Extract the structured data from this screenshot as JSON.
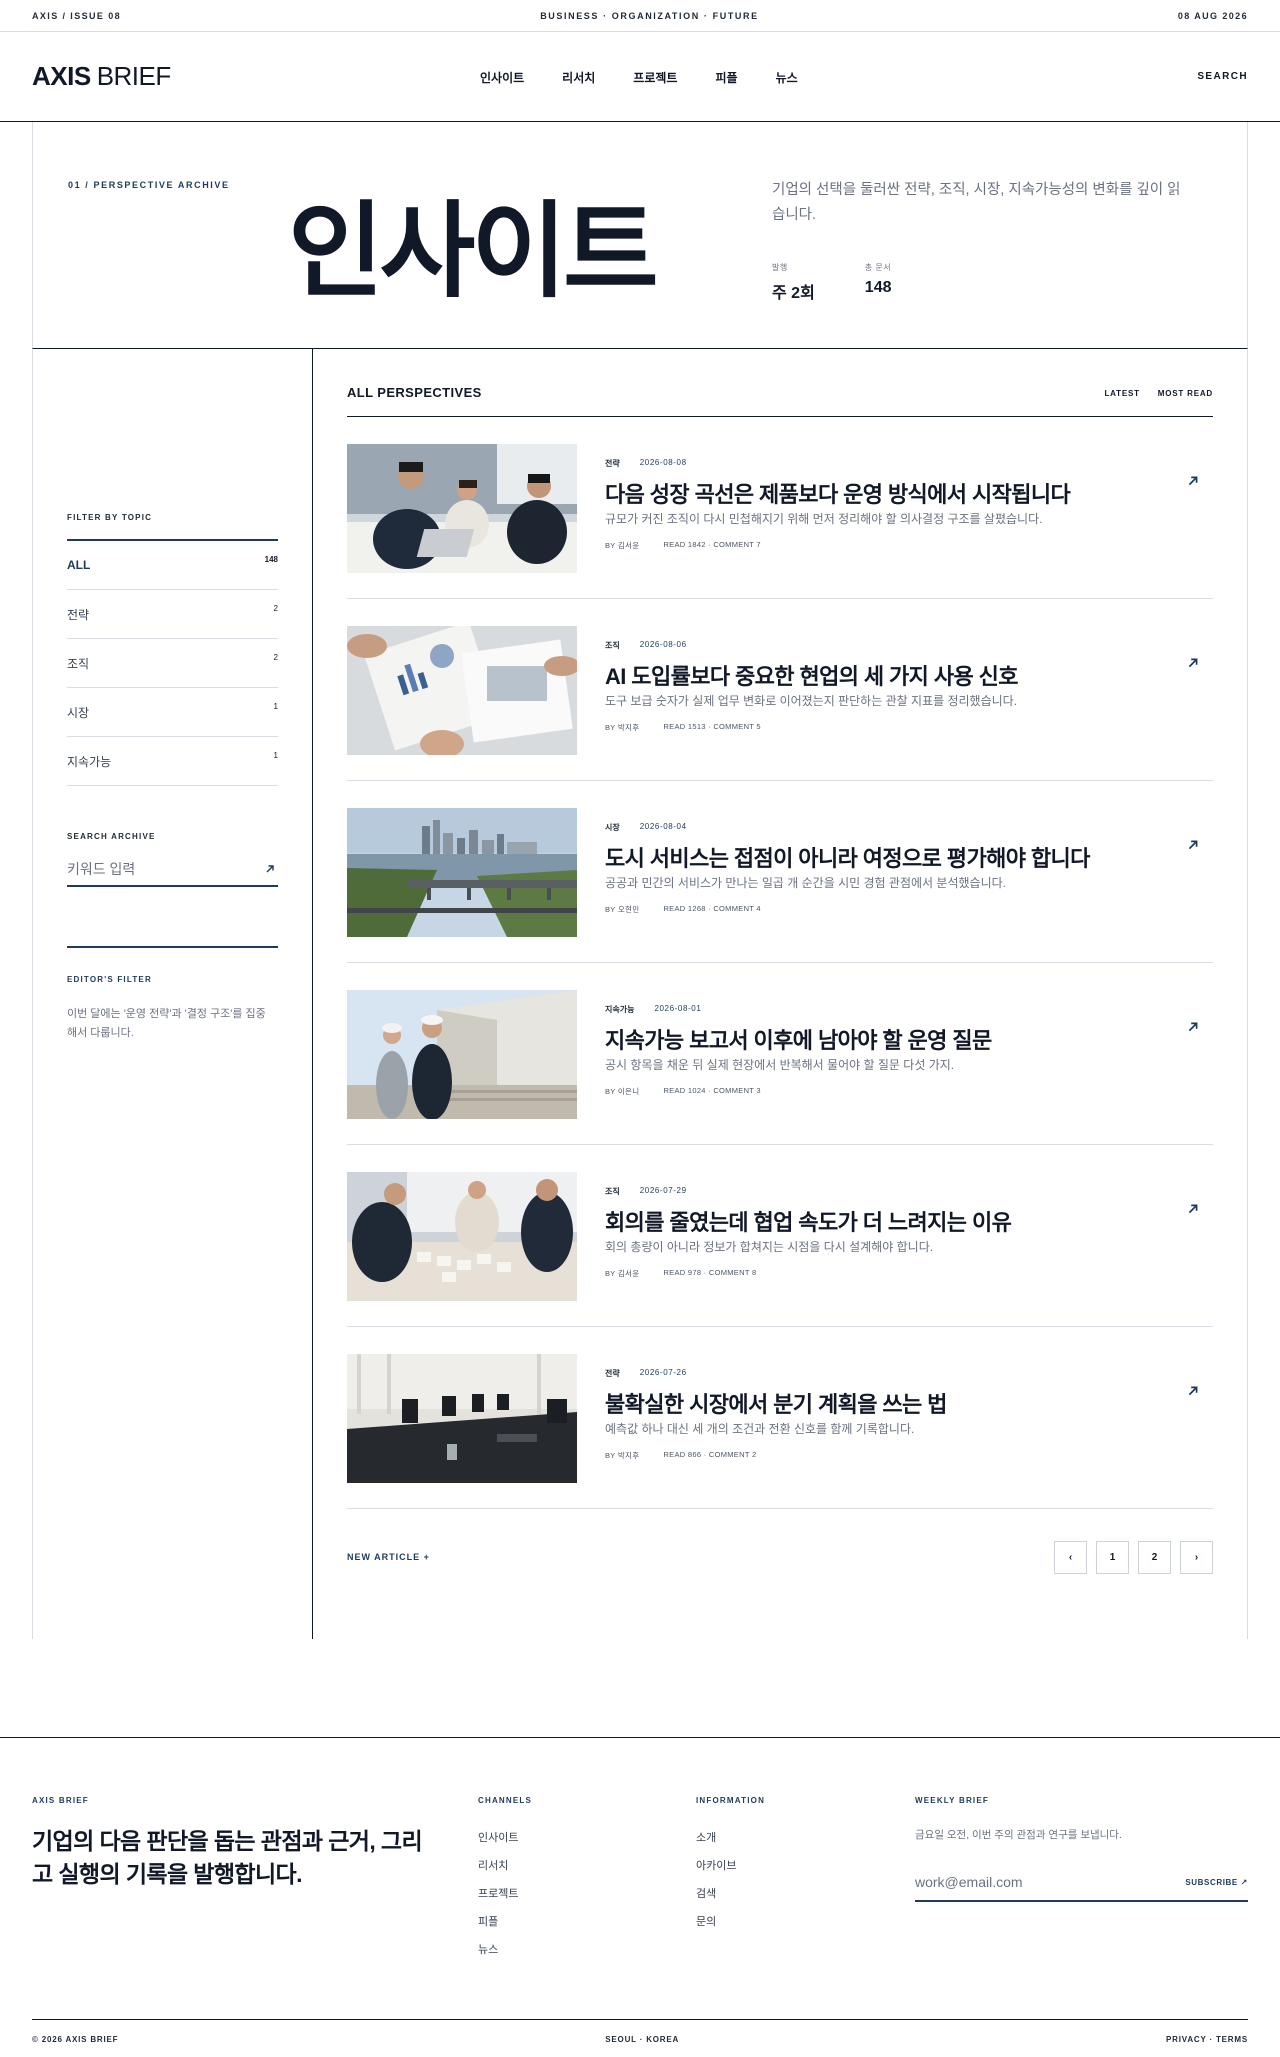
{
  "topbar": {
    "issue": "AXIS / ISSUE 08",
    "tagline": "BUSINESS · ORGANIZATION · FUTURE",
    "date": "08 AUG 2026"
  },
  "header": {
    "logo_bold": "AXIS",
    "logo_light": "BRIEF",
    "nav": [
      "인사이트",
      "리서치",
      "프로젝트",
      "피플",
      "뉴스"
    ],
    "search_label": "SEARCH"
  },
  "hero": {
    "kicker": "01 / PERSPECTIVE ARCHIVE",
    "title": "인사이트",
    "description": "기업의 선택을 둘러싼 전략, 조직, 시장, 지속가능성의 변화를 깊이 읽습니다.",
    "stats": [
      {
        "label": "발행",
        "value": "주 2회"
      },
      {
        "label": "총 문서",
        "value": "148"
      }
    ]
  },
  "sidebar": {
    "filter_label": "FILTER BY TOPIC",
    "topics": [
      {
        "label": "ALL",
        "count": "148"
      },
      {
        "label": "전략",
        "count": "2"
      },
      {
        "label": "조직",
        "count": "2"
      },
      {
        "label": "시장",
        "count": "1"
      },
      {
        "label": "지속가능",
        "count": "1"
      }
    ],
    "search_label": "SEARCH ARCHIVE",
    "search_placeholder": "키워드 입력",
    "editor_label": "EDITOR'S FILTER",
    "editor_note": "이번 달에는 '운영 전략'과 '결정 구조'를 집중해서 다룹니다."
  },
  "list": {
    "title": "ALL PERSPECTIVES",
    "sort": [
      "LATEST",
      "MOST READ"
    ],
    "articles": [
      {
        "category": "전략",
        "date": "2026-08-08",
        "title": "다음 성장 곡선은 제품보다 운영 방식에서 시작됩니다",
        "desc": "규모가 커진 조직이 다시 민첩해지기 위해 먼저 정리해야 할 의사결정 구조를 살폈습니다.",
        "author": "BY 김서윤",
        "stats": "READ 1842 · COMMENT 7",
        "image": "team-laptop-photo"
      },
      {
        "category": "조직",
        "date": "2026-08-06",
        "title": "AI 도입률보다 중요한 현업의 세 가지 사용 신호",
        "desc": "도구 보급 숫자가 실제 업무 변화로 이어졌는지 판단하는 관찰 지표를 정리했습니다.",
        "author": "BY 박지후",
        "stats": "READ 1513 · COMMENT 5",
        "image": "charts-paper-photo"
      },
      {
        "category": "시장",
        "date": "2026-08-04",
        "title": "도시 서비스는 접점이 아니라 여정으로 평가해야 합니다",
        "desc": "공공과 민간의 서비스가 만나는 일곱 개 순간을 시민 경험 관점에서 분석했습니다.",
        "author": "BY 오현민",
        "stats": "READ 1268 · COMMENT 4",
        "image": "city-bridge-photo"
      },
      {
        "category": "지속가능",
        "date": "2026-08-01",
        "title": "지속가능 보고서 이후에 남아야 할 운영 질문",
        "desc": "공시 항목을 채운 뒤 실제 현장에서 반복해서 물어야 할 질문 다섯 가지.",
        "author": "BY 이은니",
        "stats": "READ 1024 · COMMENT 3",
        "image": "site-inspection-photo"
      },
      {
        "category": "조직",
        "date": "2026-07-29",
        "title": "회의를 줄였는데 협업 속도가 더 느려지는 이유",
        "desc": "회의 총량이 아니라 정보가 합쳐지는 시점을 다시 설계해야 합니다.",
        "author": "BY 김서윤",
        "stats": "READ 978 · COMMENT 8",
        "image": "planning-table-photo"
      },
      {
        "category": "전략",
        "date": "2026-07-26",
        "title": "불확실한 시장에서 분기 계획을 쓰는 법",
        "desc": "예측값 하나 대신 세 개의 조건과 전환 신호를 함께 기록합니다.",
        "author": "BY 박지후",
        "stats": "READ 866 · COMMENT 2",
        "image": "boardroom-photo"
      }
    ],
    "new_article": "NEW ARTICLE +",
    "pager": [
      "‹",
      "1",
      "2",
      "›"
    ]
  },
  "footer": {
    "brand": "AXIS BRIEF",
    "tagline": "기업의 다음 판단을 돕는 관점과 근거, 그리고 실행의 기록을 발행합니다.",
    "channels_title": "CHANNELS",
    "channels": [
      "인사이트",
      "리서치",
      "프로젝트",
      "피플",
      "뉴스"
    ],
    "info_title": "INFORMATION",
    "info": [
      "소개",
      "아카이브",
      "검색",
      "문의"
    ],
    "weekly_title": "WEEKLY BRIEF",
    "weekly_desc": "금요일 오전, 이번 주의 관점과 연구를 보냅니다.",
    "email_placeholder": "work@email.com",
    "subscribe": "SUBSCRIBE ↗",
    "copyright": "© 2026 AXIS BRIEF",
    "location": "SEOUL · KOREA",
    "legal": "PRIVACY · TERMS"
  },
  "colors": {
    "accent": "#1e3a5f",
    "ink": "#111827",
    "muted": "#6b7280",
    "rule": "#d9dde3"
  }
}
